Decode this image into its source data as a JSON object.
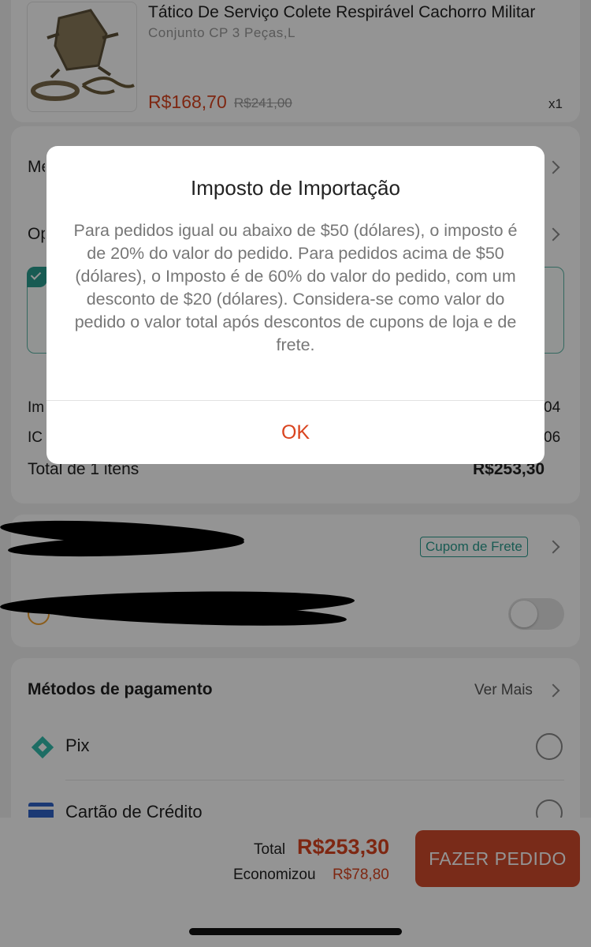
{
  "product": {
    "title": "Tático De Serviço Colete Respirável Cachorro Militar",
    "variant": "Conjunto CP 3 Peças,L",
    "price": "R$168,70",
    "old_price": "R$241,00",
    "quantity": "x1"
  },
  "rows": {
    "shipping_method_partial": "Me",
    "options_partial": "Op",
    "import_tax_partial": "Im",
    "icms_partial": "IC",
    "import_tax_value_partial": "04",
    "icms_value_partial": "06"
  },
  "order_total": {
    "label": "Total de 1 itens",
    "value": "R$253,30"
  },
  "coupon": {
    "label": "Cupom de Frete"
  },
  "payment": {
    "title": "Métodos de pagamento",
    "see_more": "Ver Mais",
    "methods": [
      {
        "label": "Pix"
      },
      {
        "label": "Cartão de Crédito"
      }
    ]
  },
  "footer": {
    "total_label": "Total",
    "total_value": "R$253,30",
    "saved_label": "Economizou",
    "saved_value": "R$78,80",
    "order_button": "FAZER PEDIDO"
  },
  "modal": {
    "title": "Imposto de Importação",
    "body": "Para pedidos igual ou abaixo de $50 (dólares), o imposto é de 20% do valor do pedido. Para pedidos acima de $50 (dólares), o Imposto é de 60% do valor do pedido, com um desconto de $20 (dólares). Considera-se como valor do pedido o valor total após descontos de cupons de loja e de frete.",
    "ok": "OK"
  },
  "colors": {
    "accent": "#d9441f",
    "order_button": "#d14a2b",
    "coupon_green": "#2a9d8f",
    "pix_green": "#32bcad",
    "card_blue": "#2f63c9"
  }
}
